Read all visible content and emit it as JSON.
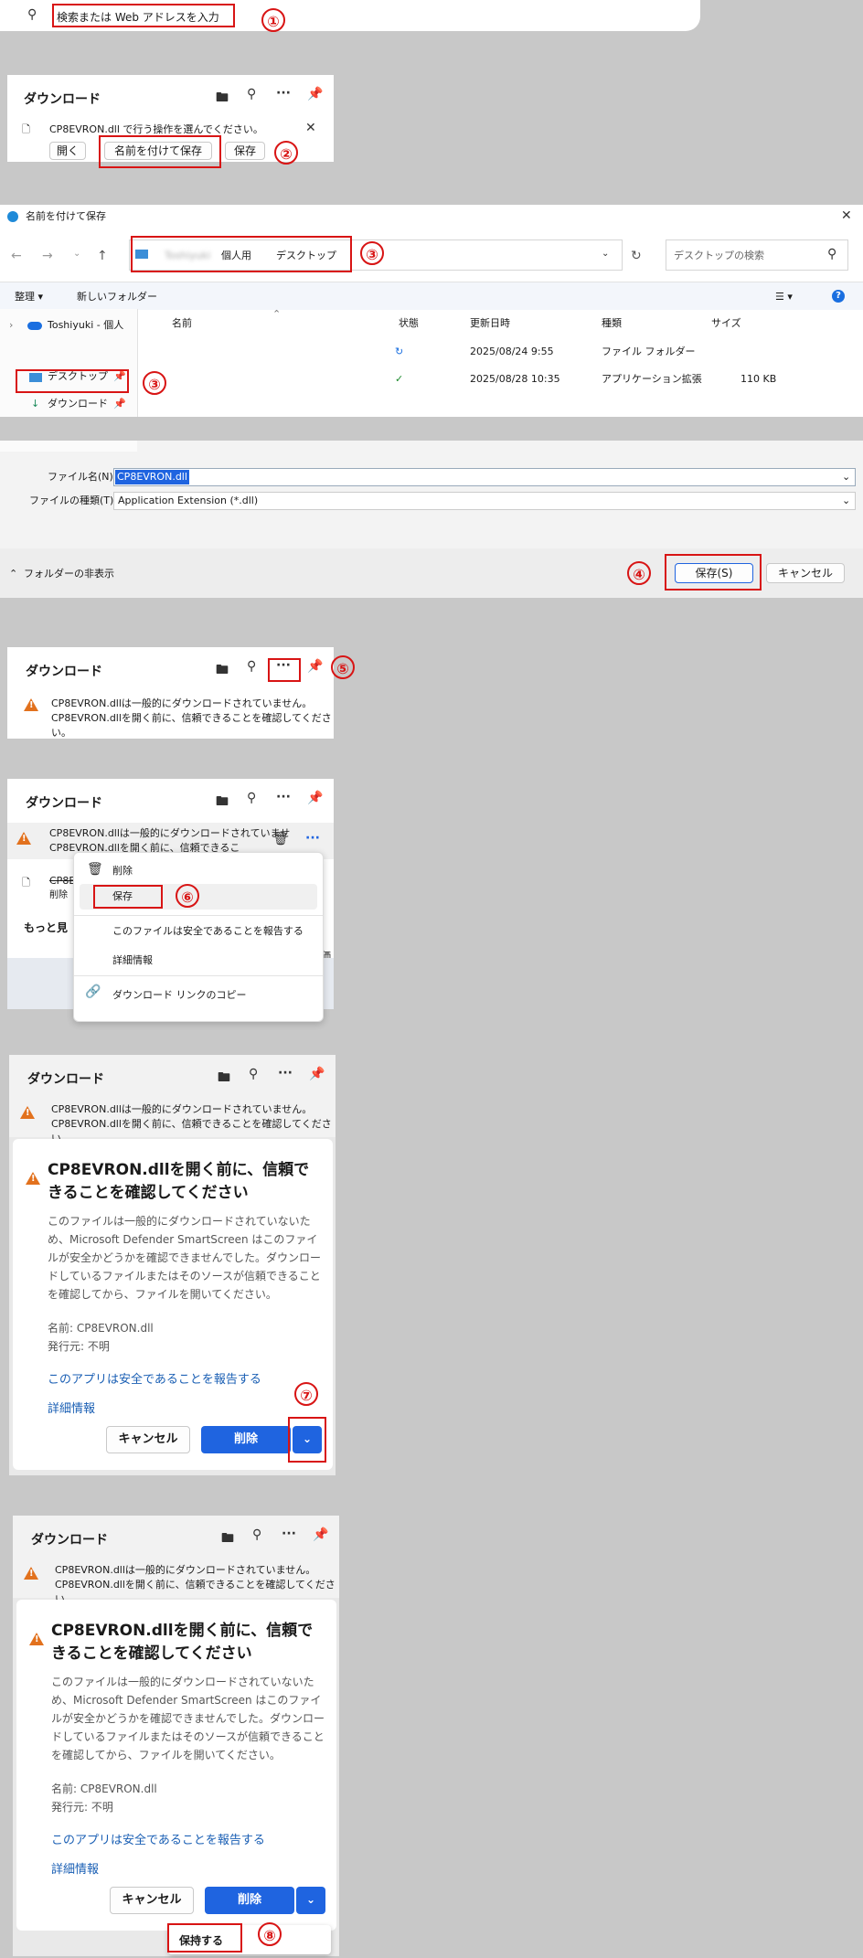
{
  "address_bar": {
    "placeholder": "検索または Web アドレスを入力"
  },
  "downloads_title": "ダウンロード",
  "step_labels": [
    "①",
    "②",
    "③",
    "③",
    "④",
    "⑤",
    "⑥",
    "⑦",
    "⑧"
  ],
  "panel1": {
    "message": "CP8EVRON.dll で行う操作を選んでください。",
    "open": "開く",
    "save_as": "名前を付けて保存",
    "save": "保存"
  },
  "save_dialog": {
    "title": "名前を付けて保存",
    "crumb_user": "Toshiyuki",
    "crumb_personal": "個人用",
    "crumb_desktop": "デスクトップ",
    "search_placeholder": "デスクトップの検索",
    "organize": "整理 ▾",
    "new_folder": "新しいフォルダー",
    "tree_onedrive": "Toshiyuki - 個人",
    "tree_desktop": "デスクトップ",
    "tree_downloads": "ダウンロード",
    "col_name": "名前",
    "col_status": "状態",
    "col_modified": "更新日時",
    "col_type": "種類",
    "col_size": "サイズ",
    "rows": [
      {
        "modified": "2025/08/24 9:55",
        "type": "ファイル フォルダー",
        "size": ""
      },
      {
        "modified": "2025/08/28 10:35",
        "type": "アプリケーション拡張",
        "size": "110 KB"
      }
    ],
    "filename_label": "ファイル名(N):",
    "filename_value": "CP8EVRON.dll",
    "filetype_label": "ファイルの種類(T):",
    "filetype_value": "Application Extension (*.dll)",
    "hide_folders": "フォルダーの非表示",
    "save_btn": "保存(S)",
    "cancel_btn": "キャンセル"
  },
  "warning": {
    "line1": "CP8EVRON.dllは一般的にダウンロードされていません。",
    "line2": "CP8EVRON.dllを開く前に、信頼できることを確認してください。"
  },
  "menu": {
    "line1": "CP8EVRON.dllは一般的にダウンロードされていませ",
    "line2": "CP8EVRON.dllを開く前に、信頼できるこ",
    "other_item": "CP8E",
    "other_sub": "削除",
    "more": "もっと見",
    "delete": "削除",
    "save": "保存",
    "report": "このファイルは安全であることを報告する",
    "details": "詳細情報",
    "copy_link": "ダウンロード リンクのコピー",
    "side_char": "価"
  },
  "confirm": {
    "title": "CP8EVRON.dllを開く前に、信頼できることを確認してください",
    "body": "このファイルは一般的にダウンロードされていないため、Microsoft Defender SmartScreen はこのファイルが安全かどうかを確認できませんでした。ダウンロードしているファイルまたはそのソースが信頼できることを確認してから、ファイルを開いてください。",
    "name_line": "名前: CP8EVRON.dll",
    "publisher_line": "発行元: 不明",
    "report_link": "このアプリは安全であることを報告する",
    "details_link": "詳細情報",
    "cancel": "キャンセル",
    "delete": "削除",
    "keep": "保持する"
  },
  "colors": {
    "accent": "#1f64e0",
    "annotation": "#d81414",
    "warning": "#e2711d"
  }
}
